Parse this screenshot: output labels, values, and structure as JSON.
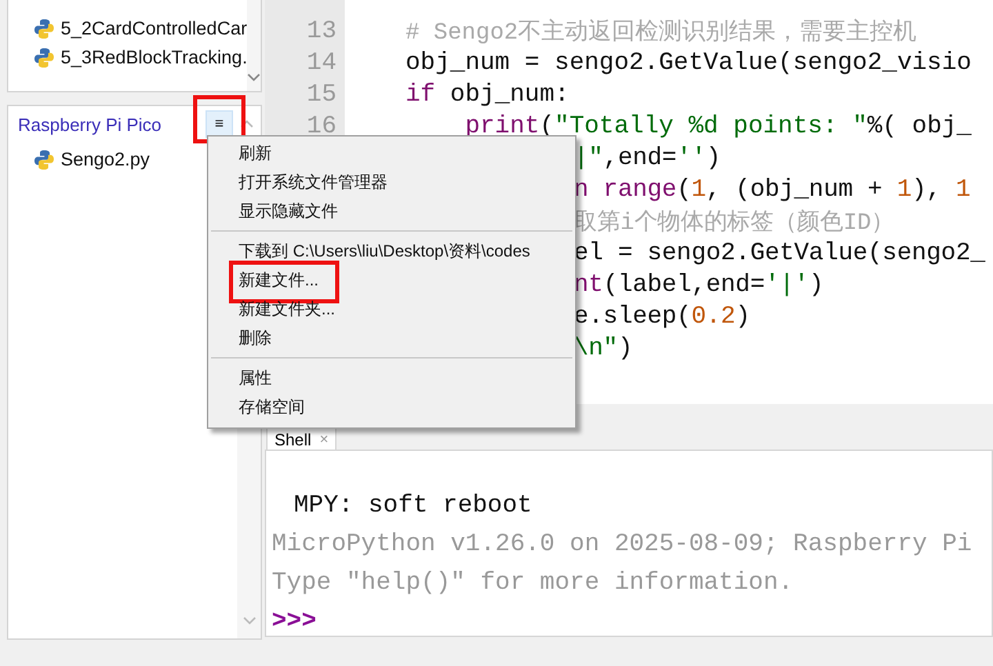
{
  "files_panel": {
    "items": [
      {
        "name": "5_2CardControlledCar"
      },
      {
        "name": "5_3RedBlockTracking."
      }
    ]
  },
  "device_panel": {
    "title": "Raspberry Pi Pico",
    "menu_button": "≡",
    "items": [
      {
        "name": "Sengo2.py"
      }
    ]
  },
  "editor": {
    "lines": [
      {
        "kind": "full",
        "number": "13",
        "tokens": [
          {
            "text": "# Sengo2不主动返回检测识别结果，需要主控机",
            "kind": "comment"
          }
        ]
      },
      {
        "kind": "full",
        "number": "14",
        "tokens": [
          {
            "text": "obj_num = sengo2.GetValue(sengo2_visio",
            "kind": "plain"
          }
        ]
      },
      {
        "kind": "full",
        "number": "15",
        "tokens": [
          {
            "text": "if",
            "kind": "keyword"
          },
          {
            "text": " obj_num:",
            "kind": "plain"
          }
        ]
      },
      {
        "kind": "full",
        "number": "16",
        "tokens": [
          {
            "text": "    print",
            "kind": "keyword"
          },
          {
            "text": "(",
            "kind": "plain"
          },
          {
            "text": "\"Totally %d points: \"",
            "kind": "string"
          },
          {
            "text": "%( obj_",
            "kind": "plain"
          }
        ]
      },
      {
        "kind": "partial",
        "tokens": [
          {
            "text": "|\"",
            "kind": "string"
          },
          {
            "text": ",end=",
            "kind": "plain"
          },
          {
            "text": "''",
            "kind": "string"
          },
          {
            "text": ")",
            "kind": "plain"
          }
        ]
      },
      {
        "kind": "partial",
        "tokens": [
          {
            "text": "n range",
            "kind": "keyword"
          },
          {
            "text": "(",
            "kind": "plain"
          },
          {
            "text": "1",
            "kind": "number"
          },
          {
            "text": ", (obj_num + ",
            "kind": "plain"
          },
          {
            "text": "1",
            "kind": "number"
          },
          {
            "text": "), ",
            "kind": "plain"
          },
          {
            "text": "1",
            "kind": "number"
          }
        ]
      },
      {
        "kind": "partial",
        "tokens": [
          {
            "text": "取第i个物体的标签（颜色ID）",
            "kind": "comment"
          }
        ]
      },
      {
        "kind": "partial",
        "tokens": [
          {
            "text": "el = sengo2.GetValue(sengo2_",
            "kind": "plain"
          }
        ]
      },
      {
        "kind": "partial",
        "tokens": [
          {
            "text": "nt",
            "kind": "keyword"
          },
          {
            "text": "(label,end=",
            "kind": "plain"
          },
          {
            "text": "'|'",
            "kind": "string"
          },
          {
            "text": ")",
            "kind": "plain"
          }
        ]
      },
      {
        "kind": "partial",
        "tokens": [
          {
            "text": "e.sleep(",
            "kind": "plain"
          },
          {
            "text": "0.2",
            "kind": "number"
          },
          {
            "text": ")",
            "kind": "plain"
          }
        ]
      },
      {
        "kind": "partial",
        "tokens": [
          {
            "text": "\\n\"",
            "kind": "string"
          },
          {
            "text": ")",
            "kind": "plain"
          }
        ]
      }
    ]
  },
  "shell": {
    "tab": {
      "label": "Shell",
      "close": "×"
    },
    "lines": [
      {
        "kind": "output",
        "text": "MPY: soft reboot"
      },
      {
        "kind": "info",
        "text": "MicroPython v1.26.0 on 2025-08-09; Raspberry Pi"
      },
      {
        "kind": "info",
        "text": "Type \"help()\" for more information."
      },
      {
        "kind": "prompt",
        "text": ">>>"
      }
    ]
  },
  "context_menu": {
    "groups": [
      [
        {
          "label": "刷新",
          "highlighted": false
        },
        {
          "label": "打开系统文件管理器",
          "highlighted": false
        },
        {
          "label": "显示隐藏文件",
          "highlighted": false
        }
      ],
      [
        {
          "label": "下载到 C:\\Users\\liu\\Desktop\\资料\\codes",
          "highlighted": false
        },
        {
          "label": "新建文件...",
          "highlighted": true
        },
        {
          "label": "新建文件夹...",
          "highlighted": false
        },
        {
          "label": "删除",
          "highlighted": false
        }
      ],
      [
        {
          "label": "属性",
          "highlighted": false
        },
        {
          "label": "存储空间",
          "highlighted": false
        }
      ]
    ]
  }
}
